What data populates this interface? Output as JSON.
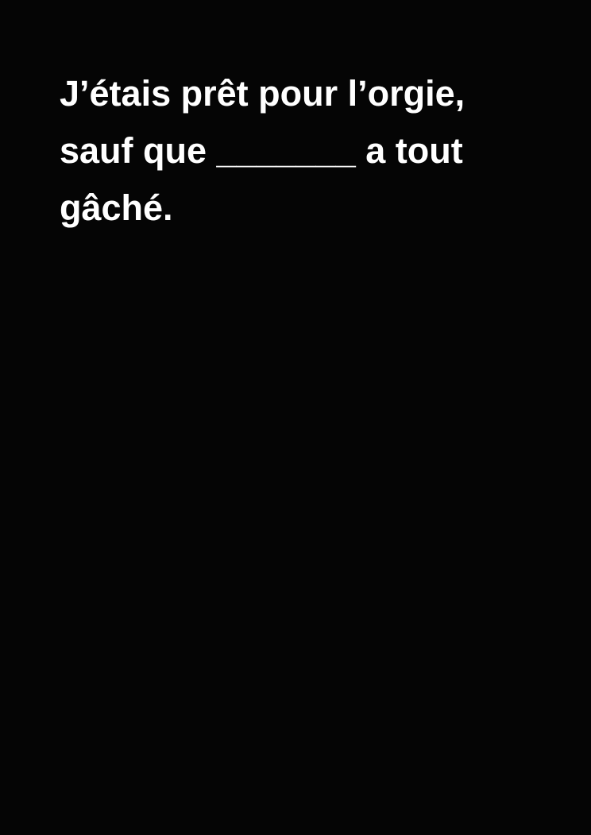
{
  "card": {
    "type": "black-question-card",
    "lines": [
      "J’étais prêt pour l’orgie,",
      "sauf que _______ a tout",
      "gâché."
    ]
  }
}
